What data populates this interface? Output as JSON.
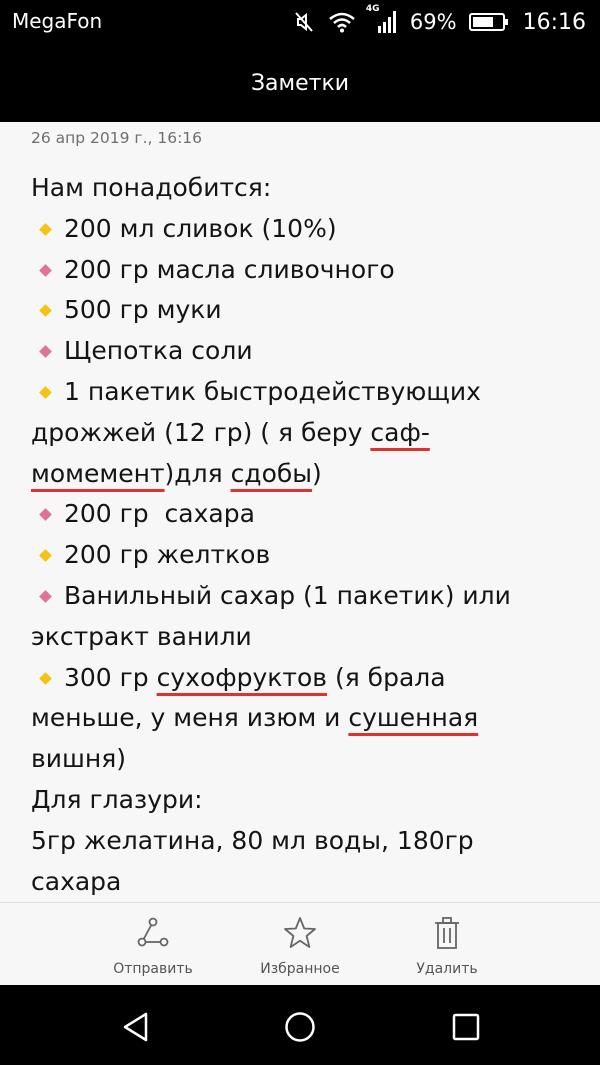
{
  "status_bar": {
    "carrier": "MegaFon",
    "network": "4G",
    "battery_percent": "69%",
    "time": "16:16",
    "icons": [
      "mute-icon",
      "wifi-icon",
      "signal-icon",
      "battery-icon"
    ]
  },
  "header": {
    "title": "Заметки"
  },
  "note": {
    "date": "26 апр 2019 г., 16:16",
    "intro": "Нам понадобится:",
    "items": [
      {
        "bullet": "yellow",
        "text": "200 мл сливок (10%)"
      },
      {
        "bullet": "pink",
        "text": "200 гр масла сливочного"
      },
      {
        "bullet": "yellow",
        "text": "500 гр муки"
      },
      {
        "bullet": "pink",
        "text": "Щепотка соли"
      }
    ],
    "yeast": {
      "bullet": "yellow",
      "line1": "1 пакетик быстродействующих",
      "line2_a": "дрожжей (12 гр) ( я беру  ",
      "line2_b": "саф-",
      "line3_a": "момемент",
      "line3_b": ")для ",
      "line3_c": "сдобы",
      "line3_d": ")"
    },
    "items2": [
      {
        "bullet": "pink",
        "text": "200 гр  сахара"
      },
      {
        "bullet": "yellow",
        "text": "200 гр желтков"
      }
    ],
    "vanilla": {
      "bullet": "pink",
      "line1": "Ванильный сахар (1 пакетик) или",
      "line2": "экстракт ванили"
    },
    "dried": {
      "bullet": "yellow",
      "line1_a": "300 гр ",
      "line1_b": "сухофруктов",
      "line1_c": " (я брала",
      "line2_a": "меньше, у меня изюм и ",
      "line2_b": "сушенная",
      "line3": "вишня)"
    },
    "glaze_title": "Для глазури:",
    "glaze_line1": "5гр желатина, 80 мл воды, 180гр",
    "glaze_line2": "сахара"
  },
  "actions": {
    "share_label": "Отправить",
    "favorite_label": "Избранное",
    "delete_label": "Удалить"
  },
  "colors": {
    "bullet_yellow": "#f5c316",
    "bullet_pink": "#e0729a",
    "spell_underline": "#e03131",
    "background": "#f7f7f7"
  }
}
